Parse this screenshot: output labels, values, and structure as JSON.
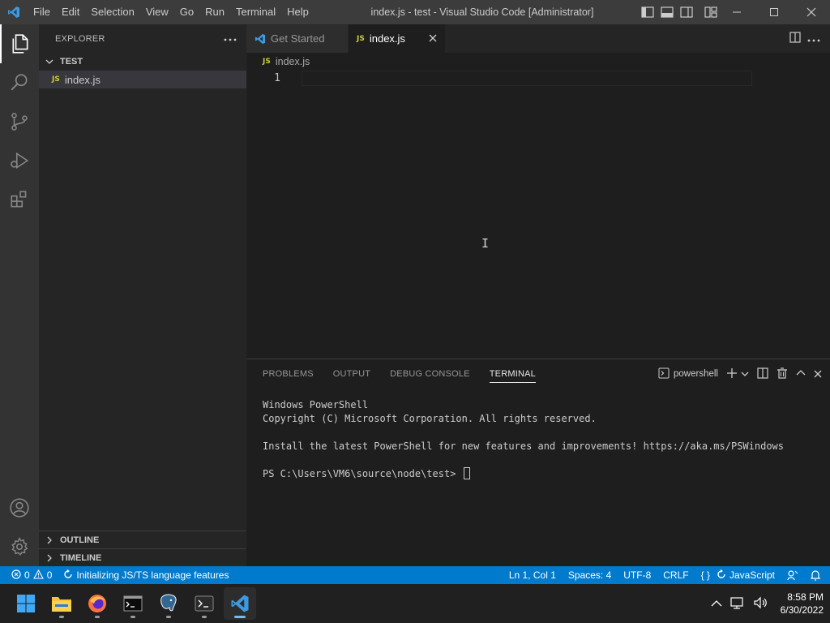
{
  "titlebar": {
    "menu": [
      "File",
      "Edit",
      "Selection",
      "View",
      "Go",
      "Run",
      "Terminal",
      "Help"
    ],
    "title": "index.js - test - Visual Studio Code [Administrator]"
  },
  "activity_bar": {
    "icons": [
      "explorer-icon",
      "search-icon",
      "source-control-icon",
      "run-debug-icon",
      "extensions-icon",
      "account-icon",
      "settings-gear-icon"
    ],
    "active": "explorer-icon"
  },
  "sidebar": {
    "title": "EXPLORER",
    "folder": "TEST",
    "files": [
      {
        "badge": "JS",
        "name": "index.js"
      }
    ],
    "sections": [
      "OUTLINE",
      "TIMELINE"
    ]
  },
  "tabs": [
    {
      "label": "Get Started",
      "active": false
    },
    {
      "label": "index.js",
      "badge": "JS",
      "active": true
    }
  ],
  "breadcrumb": {
    "badge": "JS",
    "file": "index.js"
  },
  "editor": {
    "line_numbers": [
      "1"
    ]
  },
  "panel": {
    "tabs": [
      "PROBLEMS",
      "OUTPUT",
      "DEBUG CONSOLE",
      "TERMINAL"
    ],
    "active_tab": "TERMINAL",
    "shell": "powershell",
    "terminal_lines": [
      "Windows PowerShell",
      "Copyright (C) Microsoft Corporation. All rights reserved.",
      "",
      "Install the latest PowerShell for new features and improvements! https://aka.ms/PSWindows",
      ""
    ],
    "prompt": "PS C:\\Users\\VM6\\source\\node\\test> "
  },
  "statusbar": {
    "errors": "0",
    "warnings": "0",
    "task": "Initializing JS/TS language features",
    "position": "Ln 1, Col 1",
    "spaces": "Spaces: 4",
    "encoding": "UTF-8",
    "eol": "CRLF",
    "language": "JavaScript",
    "brackets": "{ }"
  },
  "taskbar": {
    "apps": [
      "windows-start-icon",
      "file-explorer-icon",
      "firefox-icon",
      "command-prompt-icon",
      "postgresql-icon",
      "terminal-icon",
      "vscode-icon"
    ],
    "time": "8:58 PM",
    "date": "6/30/2022"
  },
  "colors": {
    "accent": "#007acc",
    "vscode_blue": "#3b9ae1",
    "js_yellow": "#cbcb41"
  }
}
